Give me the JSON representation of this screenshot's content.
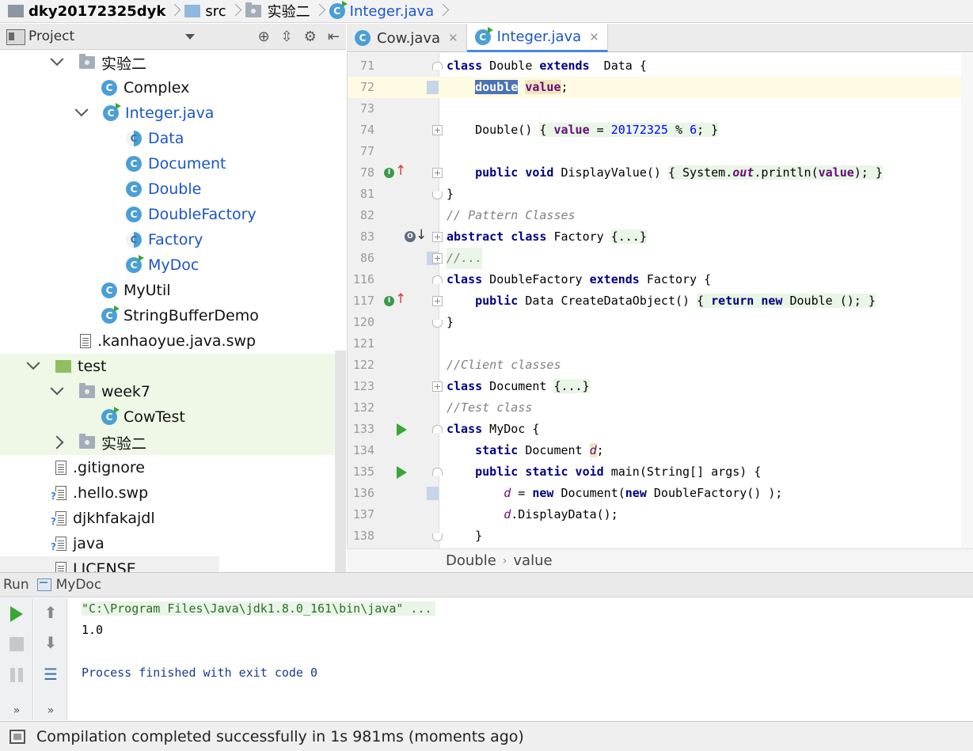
{
  "navbar": {
    "crumbs": [
      {
        "label": "dky20172325dyk",
        "icon": "project-folder-icon"
      },
      {
        "label": "src",
        "icon": "source-folder-icon"
      },
      {
        "label": "实验二",
        "icon": "package-icon"
      },
      {
        "label": "Integer.java",
        "icon": "class-icon"
      }
    ]
  },
  "project_panel": {
    "title": "Project",
    "tree": [
      {
        "label": "实验二",
        "kind": "package",
        "expanded": true
      },
      {
        "label": "Complex",
        "kind": "class"
      },
      {
        "label": "Integer.java",
        "kind": "class-runnable",
        "expanded": true
      },
      {
        "label": "Data",
        "kind": "abstract-class"
      },
      {
        "label": "Document",
        "kind": "class"
      },
      {
        "label": "Double",
        "kind": "class"
      },
      {
        "label": "DoubleFactory",
        "kind": "class"
      },
      {
        "label": "Factory",
        "kind": "abstract-class"
      },
      {
        "label": "MyDoc",
        "kind": "class-runnable"
      },
      {
        "label": "MyUtil",
        "kind": "class"
      },
      {
        "label": "StringBufferDemo",
        "kind": "class-runnable"
      },
      {
        "label": ".kanhaoyue.java.swp",
        "kind": "file"
      },
      {
        "label": "test",
        "kind": "test-folder",
        "expanded": true
      },
      {
        "label": "week7",
        "kind": "package",
        "expanded": true
      },
      {
        "label": "CowTest",
        "kind": "class-runnable"
      },
      {
        "label": "实验二",
        "kind": "package",
        "expanded": false
      },
      {
        "label": ".gitignore",
        "kind": "file"
      },
      {
        "label": ".hello.swp",
        "kind": "file-unknown"
      },
      {
        "label": "djkhfakajdl",
        "kind": "file-unknown"
      },
      {
        "label": "java",
        "kind": "file-unknown"
      },
      {
        "label": "LICENSE",
        "kind": "file"
      }
    ]
  },
  "editor_tabs": [
    {
      "label": "Cow.java",
      "active": false
    },
    {
      "label": "Integer.java",
      "active": true
    }
  ],
  "editor": {
    "lines": [
      {
        "n": "71",
        "text": "class Double extends  Data {"
      },
      {
        "n": "72",
        "text": "    double value;"
      },
      {
        "n": "73",
        "text": ""
      },
      {
        "n": "74",
        "text": "    Double() { value = 20172325 % 6; }"
      },
      {
        "n": "77",
        "text": ""
      },
      {
        "n": "78",
        "text": "    public void DisplayValue() { System.out.println(value); }"
      },
      {
        "n": "81",
        "text": "}"
      },
      {
        "n": "82",
        "text": "// Pattern Classes"
      },
      {
        "n": "83",
        "text": "abstract class Factory {...}"
      },
      {
        "n": "86",
        "text": "//..."
      },
      {
        "n": "116",
        "text": "class DoubleFactory extends Factory {"
      },
      {
        "n": "117",
        "text": "    public Data CreateDataObject() { return new Double (); }"
      },
      {
        "n": "120",
        "text": "}"
      },
      {
        "n": "121",
        "text": ""
      },
      {
        "n": "122",
        "text": "//Client classes"
      },
      {
        "n": "123",
        "text": "class Document {...}"
      },
      {
        "n": "132",
        "text": "//Test class"
      },
      {
        "n": "133",
        "text": "class MyDoc {"
      },
      {
        "n": "134",
        "text": "    static Document d;"
      },
      {
        "n": "135",
        "text": "    public static void main(String[] args) {"
      },
      {
        "n": "136",
        "text": "        d = new Document(new DoubleFactory() );"
      },
      {
        "n": "137",
        "text": "        d.DisplayData();"
      },
      {
        "n": "138",
        "text": "    }"
      }
    ],
    "breadcrumb": [
      "Double",
      "value"
    ]
  },
  "run_panel": {
    "label": "Run",
    "config": "MyDoc",
    "console": [
      "\"C:\\Program Files\\Java\\jdk1.8.0_161\\bin\\java\" ...",
      "1.0",
      "",
      "Process finished with exit code 0"
    ],
    "more_glyph": "»"
  },
  "status": {
    "message": "Compilation completed successfully in 1s 981ms (moments ago)"
  },
  "colors": {
    "accent": "#1a56c4",
    "run_green": "#3aa635",
    "keyword": "#000080",
    "current_line": "#fffae3"
  }
}
